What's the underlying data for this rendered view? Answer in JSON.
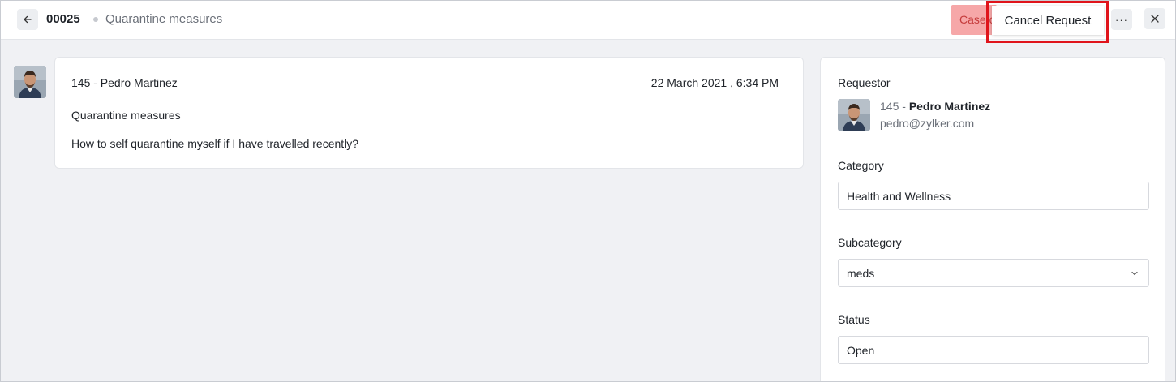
{
  "header": {
    "ticket_id": "00025",
    "ticket_title": "Quarantine measures",
    "case_button_label": "Case c",
    "cancel_request_label": "Cancel Request",
    "more_label": "···"
  },
  "message": {
    "author": "145 - Pedro Martinez",
    "date": "22 March 2021 , 6:34 PM",
    "subject": "Quarantine measures",
    "body": "How to self quarantine myself if I have travelled recently?"
  },
  "side_panel": {
    "requestor_label": "Requestor",
    "requestor_id": "145 - ",
    "requestor_name": "Pedro Martinez",
    "requestor_email": "pedro@zylker.com",
    "category_label": "Category",
    "category_value": "Health and Wellness",
    "subcategory_label": "Subcategory",
    "subcategory_value": "meds",
    "status_label": "Status",
    "status_value": "Open"
  },
  "colors": {
    "highlight": "#e0141b",
    "case_button_bg": "#f6a7a8",
    "page_bg": "#f0f1f4"
  },
  "icons": {
    "back": "arrow-left-icon",
    "more": "more-horizontal-icon",
    "close": "close-icon",
    "dropdown": "chevron-down-icon"
  }
}
